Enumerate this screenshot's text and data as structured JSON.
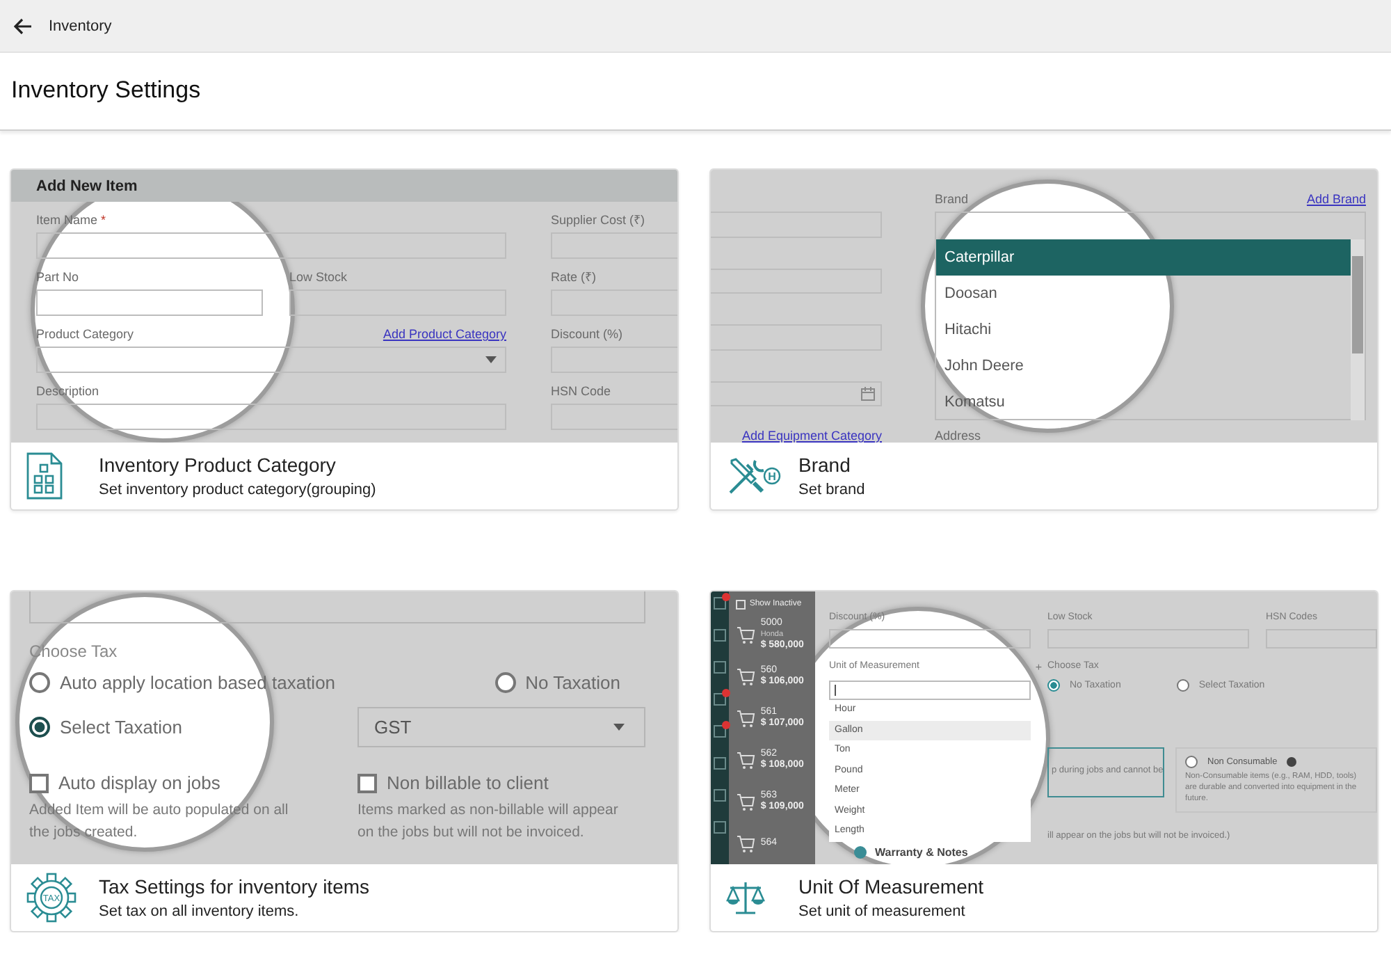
{
  "topbar": {
    "title": "Inventory"
  },
  "page_title": "Inventory Settings",
  "cards": [
    {
      "kind": "category",
      "title": "Inventory Product Category",
      "subtitle": "Set inventory product category(grouping)",
      "preview": {
        "heading": "Add New Item",
        "item_name": "Item Name",
        "required_mark": "*",
        "part_no": "Part No",
        "low_stock": "Low Stock",
        "product_category": "Product Category",
        "add_link": "Add Product Category",
        "description": "Description",
        "side_labels": [
          "Supplier Cost (₹)",
          "Rate (₹)",
          "Discount (%)",
          "HSN Code"
        ]
      }
    },
    {
      "kind": "brand",
      "title": "Brand",
      "subtitle": "Set brand",
      "icon_text": "H",
      "preview": {
        "brand_label": "Brand",
        "add_link": "Add Brand",
        "options": [
          {
            "label": "Caterpillar",
            "selected": true
          },
          {
            "label": "Doosan",
            "selected": false
          },
          {
            "label": "Hitachi",
            "selected": false
          },
          {
            "label": "John Deere",
            "selected": false
          },
          {
            "label": "Komatsu",
            "selected": false
          }
        ],
        "equipment_link": "Add Equipment Category",
        "address_label": "Address"
      }
    },
    {
      "kind": "tax",
      "title": "Tax Settings for inventory items",
      "subtitle": "Set tax on all inventory items.",
      "icon_text": "TAX",
      "preview": {
        "choose_tax": "Choose Tax",
        "radios": [
          {
            "label": "Auto apply location based taxation",
            "selected": false
          },
          {
            "label": "No Taxation",
            "selected": false
          },
          {
            "label": "Select Taxation",
            "selected": true
          }
        ],
        "tax_value": "GST",
        "checkboxes": [
          {
            "label": "Auto display on jobs",
            "checked": false,
            "note": "Added Item will be auto populated on all the jobs created."
          },
          {
            "label": "Non billable to client",
            "checked": false,
            "note": "Items marked as non-billable will appear on the jobs but will not be invoiced."
          }
        ]
      }
    },
    {
      "kind": "uom",
      "title": "Unit Of Measurement",
      "subtitle": "Set unit of measurement",
      "preview": {
        "show_inactive": {
          "label": "Show Inactive",
          "checked": false
        },
        "list": [
          {
            "number": "5000",
            "name": "Honda",
            "price": "$ 580,000"
          },
          {
            "number": "560",
            "price": "$ 106,000"
          },
          {
            "number": "561",
            "price": "$ 107,000"
          },
          {
            "number": "562",
            "price": "$ 108,000"
          },
          {
            "number": "563",
            "price": "$ 109,000"
          },
          {
            "number": "564"
          }
        ],
        "labels": [
          "Discount (%)",
          "Low Stock",
          "HSN Codes"
        ],
        "uom_label": "Unit of Measurement",
        "add_mark": "+",
        "options": [
          {
            "label": "Hour",
            "selected": false
          },
          {
            "label": "Gallon",
            "selected": true
          },
          {
            "label": "Ton",
            "selected": false
          },
          {
            "label": "Pound",
            "selected": false
          },
          {
            "label": "Meter",
            "selected": false
          },
          {
            "label": "Weight",
            "selected": false
          },
          {
            "label": "Length",
            "selected": false
          }
        ],
        "choose_tax": "Choose Tax",
        "radios": [
          {
            "label": "No Taxation",
            "selected": true
          },
          {
            "label": "Select Taxation",
            "selected": false
          }
        ],
        "consumable_note": "p during jobs and cannot be",
        "non_consumable": {
          "selected": false,
          "title": "Non Consumable",
          "note": "Non-Consumable items (e.g., RAM, HDD, tools) are durable and converted into equipment in the future."
        },
        "billing_note": "ill appear on the jobs but will not be invoiced.)",
        "section": "Warranty & Notes"
      }
    }
  ]
}
